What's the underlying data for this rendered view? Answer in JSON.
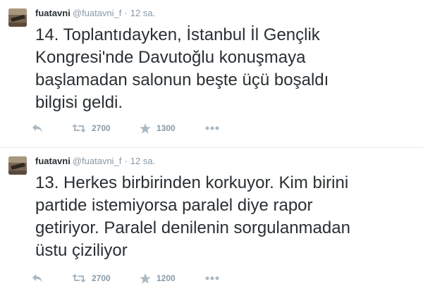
{
  "tweets": [
    {
      "fullname": "fuatavni",
      "username": "@fuatavni_f",
      "separator": "·",
      "time": "12 sa.",
      "text": "14. Toplantıdayken, İstanbul İl Gençlik\nKongresi'nde Davutoğlu konuşmaya\nbaşlamadan salonun beşte üçü boşaldı\nbilgisi geldi.",
      "retweets": "2700",
      "favorites": "1300"
    },
    {
      "fullname": "fuatavni",
      "username": "@fuatavni_f",
      "separator": "·",
      "time": "12 sa.",
      "text": "13. Herkes birbirinden korkuyor. Kim birini\npartide istemiyorsa paralel diye rapor\ngetiriyor. Paralel denilenin sorgulanmadan\nüstu çiziliyor",
      "retweets": "2700",
      "favorites": "1200"
    }
  ],
  "icons": {
    "reply": "reply-icon",
    "retweet": "retweet-icon",
    "favorite": "star-icon",
    "more": "more-icon"
  },
  "colors": {
    "text": "#292f33",
    "muted": "#8899a6",
    "divider": "#e1e8ed"
  }
}
